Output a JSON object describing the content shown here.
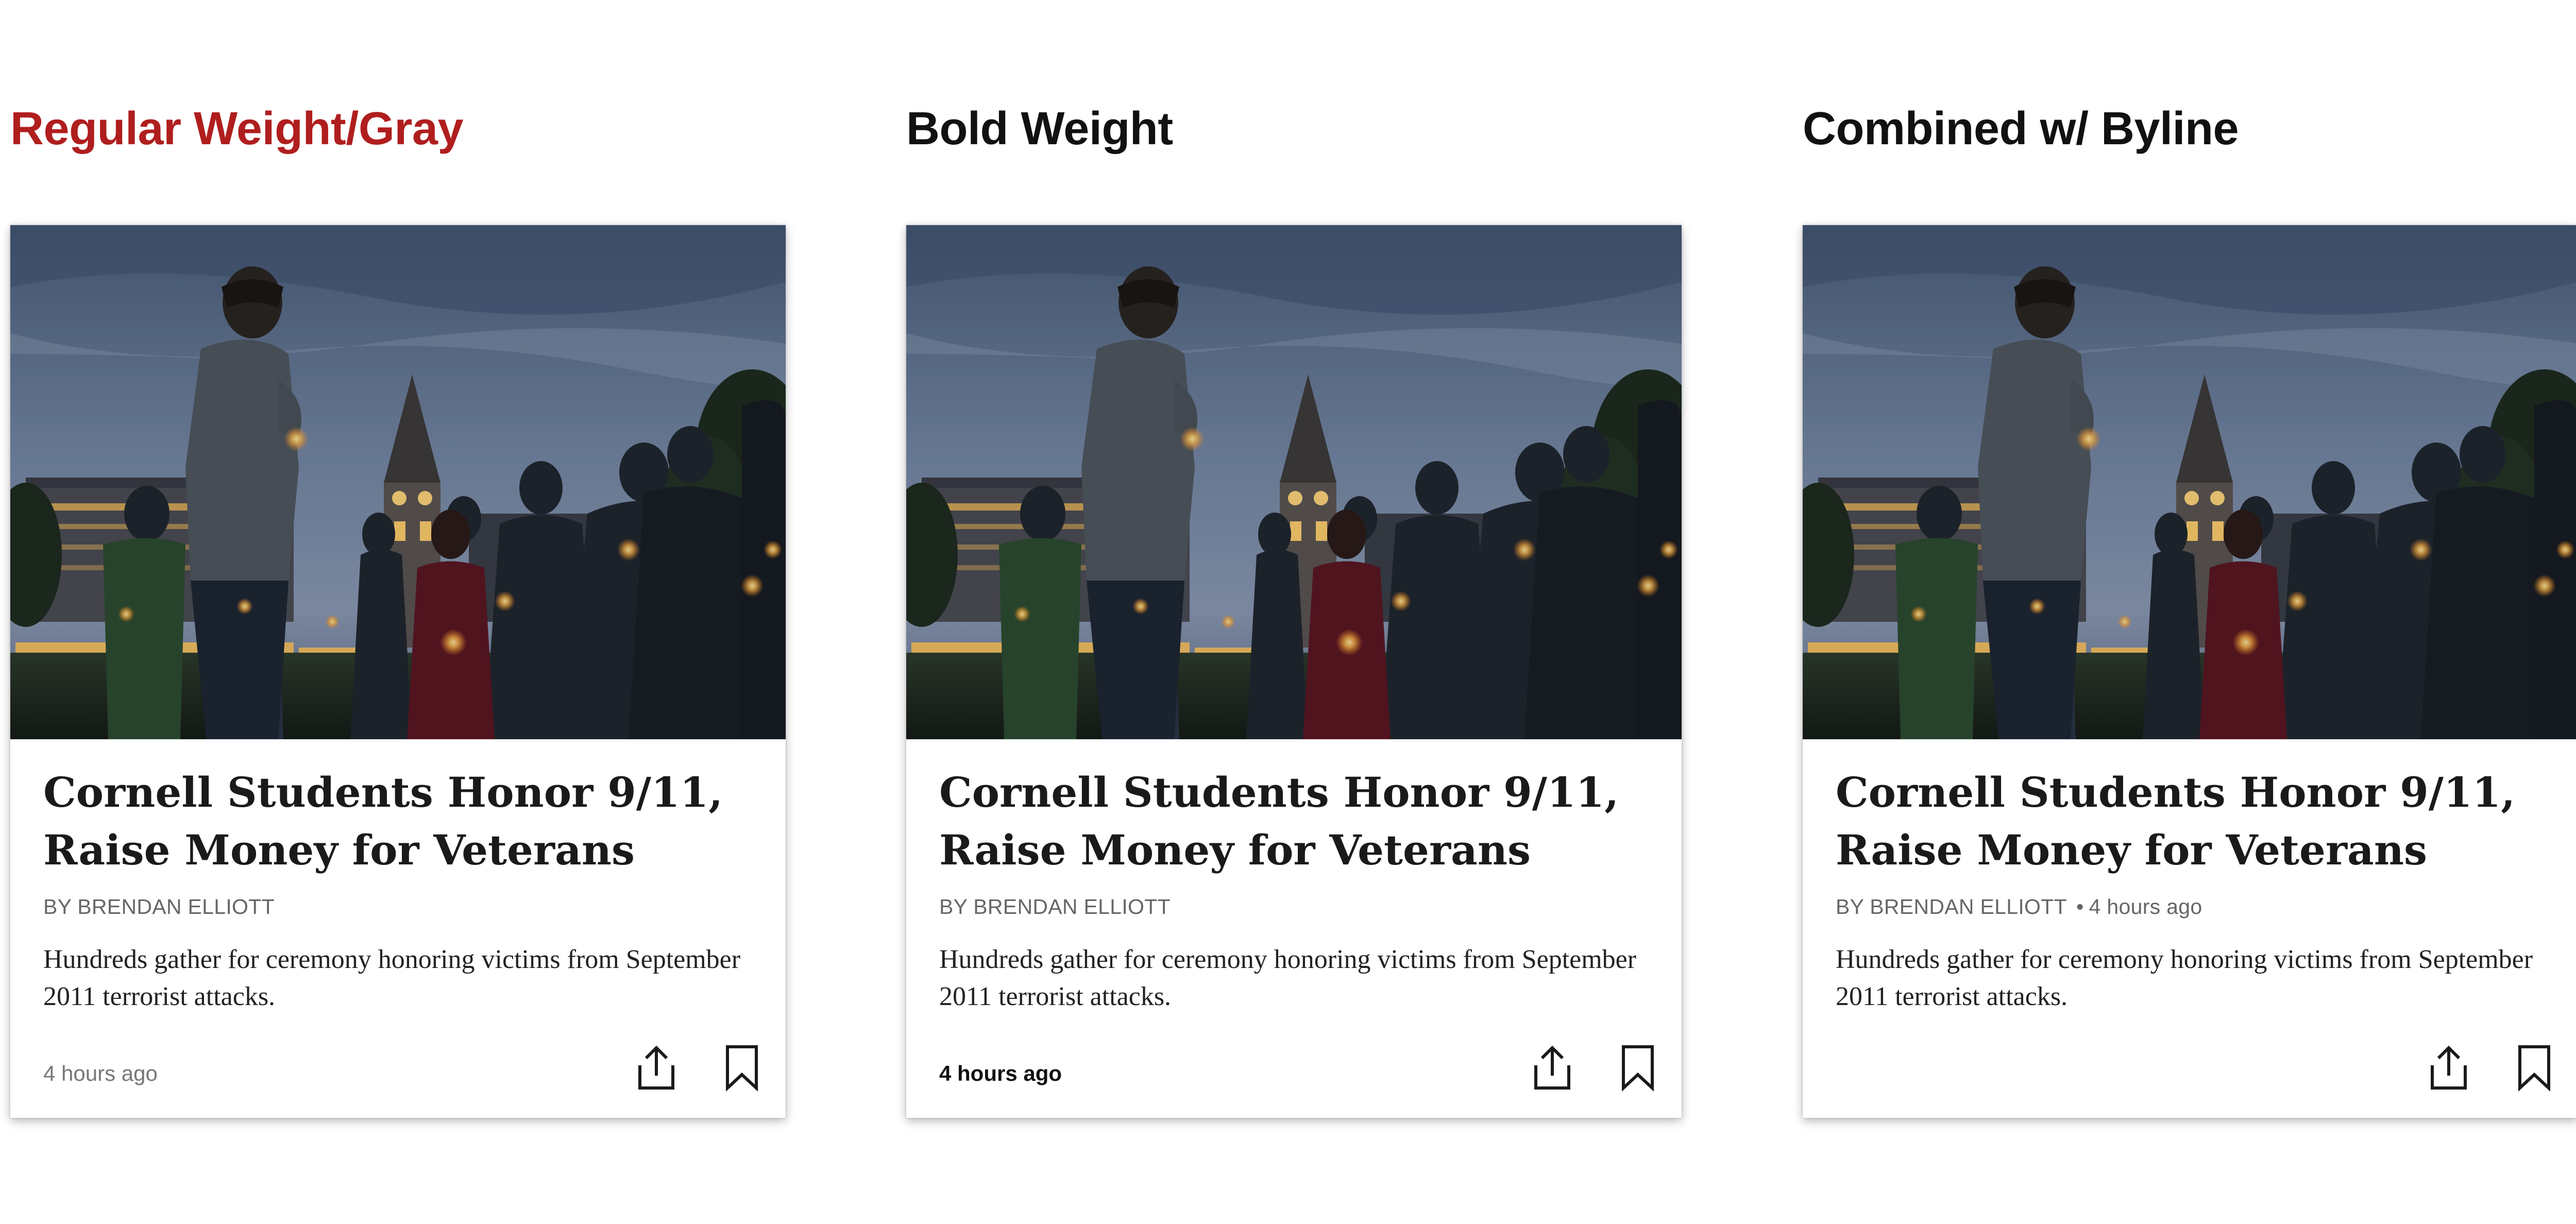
{
  "columns": [
    {
      "heading": "Regular Weight/Gray",
      "card": {
        "headline": "Cornell Students Honor 9/11, Raise Money for Veterans",
        "byline": "BY BRENDAN ELLIOTT",
        "byline_time": "",
        "dek": "Hundreds gather for ceremony honoring victims from September 2011 terrorist attacks.",
        "timestamp": "4 hours ago"
      }
    },
    {
      "heading": "Bold Weight",
      "card": {
        "headline": "Cornell Students Honor 9/11, Raise Money for Veterans",
        "byline": "BY BRENDAN ELLIOTT",
        "byline_time": "",
        "dek": "Hundreds gather for ceremony honoring victims from September 2011 terrorist attacks.",
        "timestamp": "4 hours ago"
      }
    },
    {
      "heading": "Combined w/ Byline",
      "card": {
        "headline": "Cornell Students Honor 9/11, Raise Money for Veterans",
        "byline": "BY BRENDAN ELLIOTT",
        "byline_separator": "•",
        "byline_time": "4 hours ago",
        "dek": "Hundreds gather for ceremony honoring victims from September 2011 terrorist attacks.",
        "timestamp": ""
      }
    }
  ],
  "colors": {
    "heading_accent": "#b01e1e",
    "heading_default": "#111111",
    "byline_gray": "#666666",
    "timestamp_gray": "#777777"
  },
  "icons": {
    "share": "share-icon",
    "bookmark": "bookmark-icon"
  }
}
